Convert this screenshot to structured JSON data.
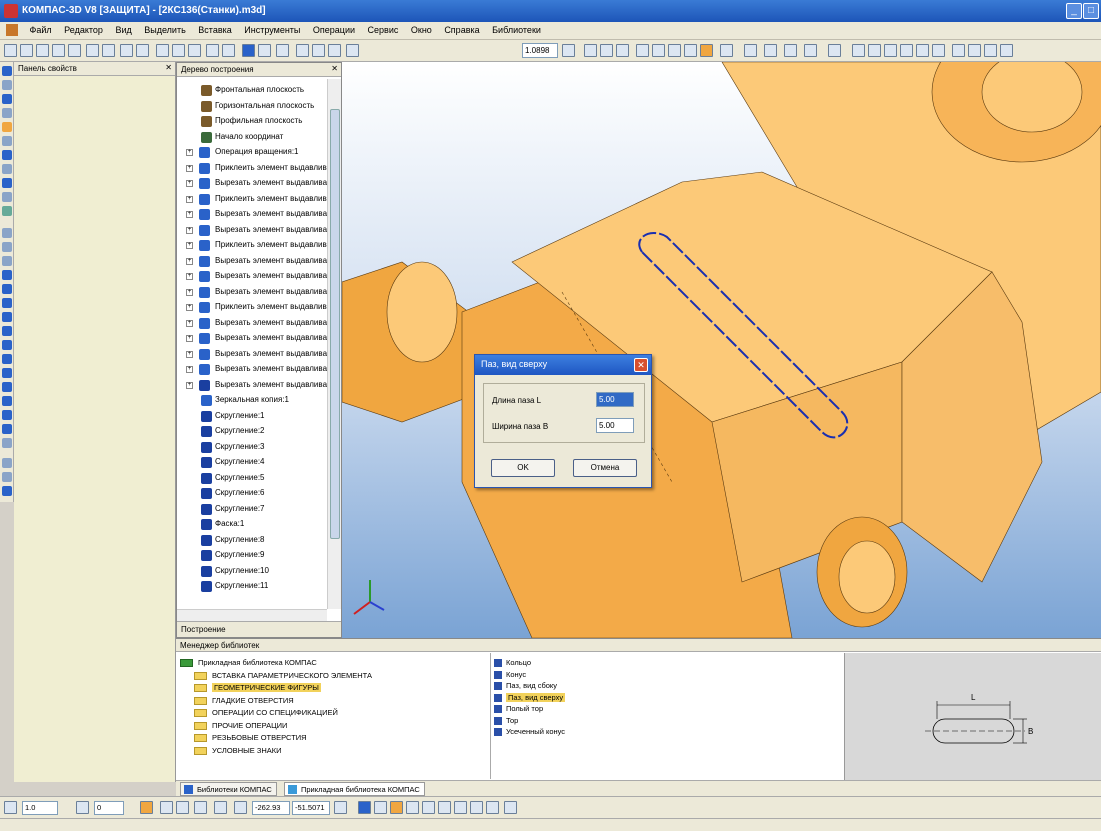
{
  "window": {
    "title": "КОМПАС-3D V8 [ЗАЩИТА] - [2КС136(Станки).m3d]"
  },
  "menu": {
    "items": [
      "Файл",
      "Редактор",
      "Вид",
      "Выделить",
      "Вставка",
      "Инструменты",
      "Операции",
      "Сервис",
      "Окно",
      "Справка",
      "Библиотеки"
    ]
  },
  "toolbar": {
    "zoom_value": "1.0898"
  },
  "props_panel": {
    "title": "Панель свойств"
  },
  "tree": {
    "title": "Дерево построения",
    "tab_label": "Построение",
    "items": [
      {
        "label": "Фронтальная плоскость",
        "type": "plane",
        "expand": false
      },
      {
        "label": "Горизонтальная плоскость",
        "type": "plane",
        "expand": false
      },
      {
        "label": "Профильная плоскость",
        "type": "plane",
        "expand": false
      },
      {
        "label": "Начало координат",
        "type": "origin",
        "expand": false
      },
      {
        "label": "Операция вращения:1",
        "type": "rotate",
        "expand": true
      },
      {
        "label": "Приклеить элемент выдавливания",
        "type": "extrude",
        "expand": true
      },
      {
        "label": "Вырезать элемент выдавливания",
        "type": "extrude",
        "expand": true
      },
      {
        "label": "Приклеить элемент выдавливания",
        "type": "extrude",
        "expand": true
      },
      {
        "label": "Вырезать элемент выдавливания",
        "type": "extrude",
        "expand": true
      },
      {
        "label": "Вырезать элемент выдавливания",
        "type": "extrude",
        "expand": true
      },
      {
        "label": "Приклеить элемент выдавливания",
        "type": "extrude",
        "expand": true
      },
      {
        "label": "Вырезать элемент выдавливания",
        "type": "extrude",
        "expand": true
      },
      {
        "label": "Вырезать элемент выдавливания",
        "type": "extrude",
        "expand": true
      },
      {
        "label": "Вырезать элемент выдавливания",
        "type": "extrude",
        "expand": true
      },
      {
        "label": "Приклеить элемент выдавливания",
        "type": "extrude",
        "expand": true
      },
      {
        "label": "Вырезать элемент выдавливания",
        "type": "extrude",
        "expand": true
      },
      {
        "label": "Вырезать элемент выдавливания",
        "type": "extrude",
        "expand": true
      },
      {
        "label": "Вырезать элемент выдавливания",
        "type": "extrude",
        "expand": true
      },
      {
        "label": "Вырезать элемент выдавливания",
        "type": "extrude",
        "expand": true
      },
      {
        "label": "Вырезать элемент выдавливания",
        "type": "cut",
        "expand": true
      },
      {
        "label": "Зеркальная копия:1",
        "type": "mirror",
        "expand": false
      },
      {
        "label": "Скругление:1",
        "type": "fillet",
        "expand": false
      },
      {
        "label": "Скругление:2",
        "type": "fillet",
        "expand": false
      },
      {
        "label": "Скругление:3",
        "type": "fillet",
        "expand": false
      },
      {
        "label": "Скругление:4",
        "type": "fillet",
        "expand": false
      },
      {
        "label": "Скругление:5",
        "type": "fillet",
        "expand": false
      },
      {
        "label": "Скругление:6",
        "type": "fillet",
        "expand": false
      },
      {
        "label": "Скругление:7",
        "type": "fillet",
        "expand": false
      },
      {
        "label": "Фаска:1",
        "type": "fillet",
        "expand": false
      },
      {
        "label": "Скругление:8",
        "type": "fillet",
        "expand": false
      },
      {
        "label": "Скругление:9",
        "type": "fillet",
        "expand": false
      },
      {
        "label": "Скругление:10",
        "type": "fillet",
        "expand": false
      },
      {
        "label": "Скругление:11",
        "type": "fillet",
        "expand": false
      }
    ]
  },
  "dialog": {
    "title": "Паз, вид сверху",
    "length_label": "Длина паза L",
    "length_value": "5.00",
    "width_label": "Ширина паза B",
    "width_value": "5.00",
    "ok_label": "OK",
    "cancel_label": "Отмена"
  },
  "library_manager": {
    "title": "Менеджер библиотек",
    "tree": [
      "Прикладная библиотека КОМПАС",
      "ВСТАВКА ПАРАМЕТРИЧЕСКОГО ЭЛЕМЕНТА",
      "ГЕОМЕТРИЧЕСКИЕ ФИГУРЫ",
      "ГЛАДКИЕ ОТВЕРСТИЯ",
      "ОПЕРАЦИИ СО СПЕЦИФИКАЦИЕЙ",
      "ПРОЧИЕ ОПЕРАЦИИ",
      "РЕЗЬБОВЫЕ ОТВЕРСТИЯ",
      "УСЛОВНЫЕ ЗНАКИ"
    ],
    "selected_tree_index": 2,
    "list": [
      "Кольцо",
      "Конус",
      "Паз, вид сбоку",
      "Паз, вид сверху",
      "Полый тор",
      "Тор",
      "Усеченный конус"
    ],
    "selected_list_index": 3,
    "preview_label_l": "L",
    "preview_label_b": "B"
  },
  "bottom_tabs": [
    "Библиотеки КОМПАС",
    "Прикладная библиотека КОМПАС"
  ],
  "status": {
    "step": "1.0",
    "angle": "0",
    "coord_x": "-262.93",
    "coord_y": "-51.5071"
  },
  "colors": {
    "part_face": "#fcc978",
    "part_shadow": "#f0a640",
    "slot_outline": "#1a2fb0",
    "accent": "#2a62c9"
  }
}
